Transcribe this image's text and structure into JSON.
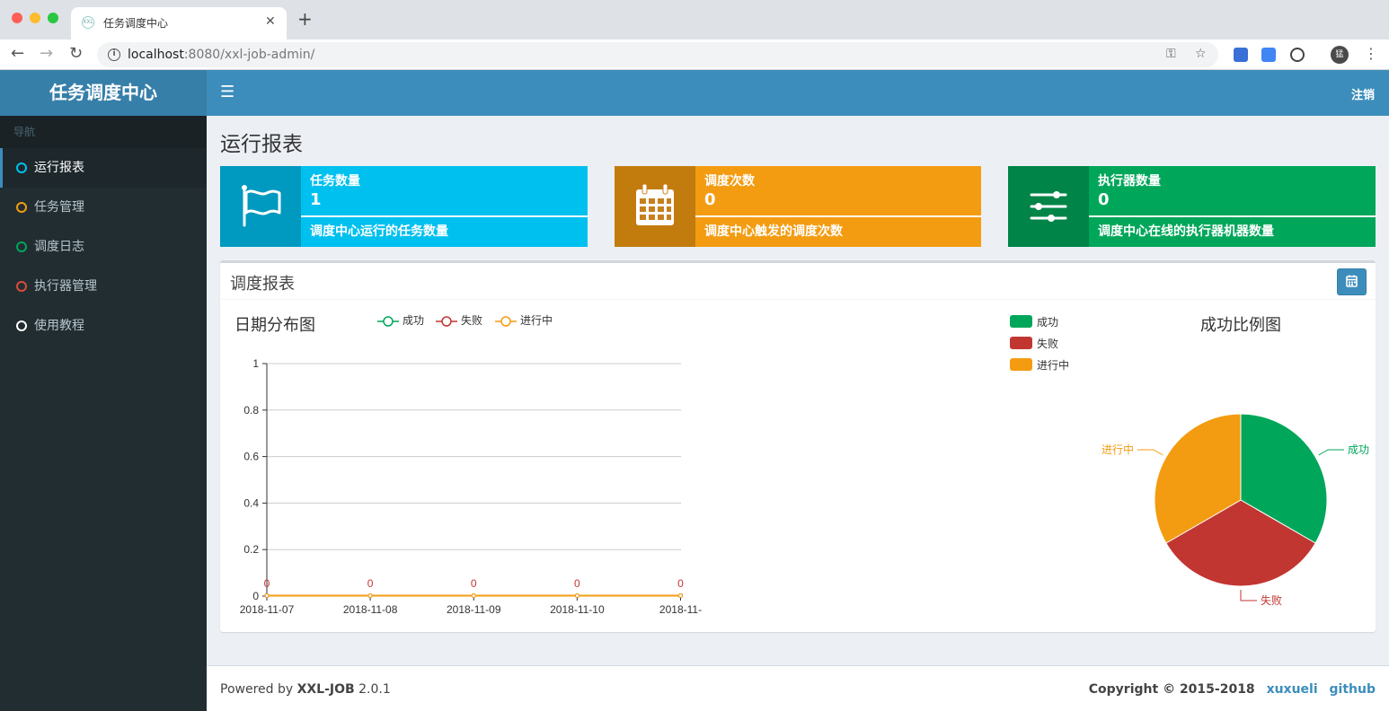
{
  "browser": {
    "tab_title": "任务调度中心",
    "favicon_text": "XXL",
    "url_host": "localhost",
    "url_rest": ":8080/xxl-job-admin/",
    "avatar_text": "猛"
  },
  "app": {
    "logo": "任务调度中心",
    "logout": "注销",
    "nav_header": "导航",
    "nav": [
      {
        "label": "运行报表",
        "color": "#00c0ef",
        "active": true
      },
      {
        "label": "任务管理",
        "color": "#f39c12"
      },
      {
        "label": "调度日志",
        "color": "#00a65a"
      },
      {
        "label": "执行器管理",
        "color": "#dd4b39"
      },
      {
        "label": "使用教程",
        "color": "#ffffff"
      }
    ]
  },
  "page": {
    "title": "运行报表",
    "info_boxes": [
      {
        "title": "任务数量",
        "value": "1",
        "desc": "调度中心运行的任务数量",
        "color": "#00c0ef",
        "icon": "flag-icon"
      },
      {
        "title": "调度次数",
        "value": "0",
        "desc": "调度中心触发的调度次数",
        "color": "#f39c12",
        "icon": "calendar-icon"
      },
      {
        "title": "执行器数量",
        "value": "0",
        "desc": "调度中心在线的执行器机器数量",
        "color": "#00a65a",
        "icon": "sliders-icon"
      }
    ],
    "report": {
      "title": "调度报表",
      "button_icon": "calendar-icon"
    }
  },
  "chart_data": [
    {
      "type": "line",
      "title": "日期分布图",
      "categories": [
        "2018-11-07",
        "2018-11-08",
        "2018-11-09",
        "2018-11-10",
        "2018-11-"
      ],
      "series": [
        {
          "name": "成功",
          "values": [
            0,
            0,
            0,
            0,
            0
          ],
          "color": "#00a65a"
        },
        {
          "name": "失败",
          "values": [
            0,
            0,
            0,
            0,
            0
          ],
          "color": "#c23632"
        },
        {
          "name": "进行中",
          "values": [
            0,
            0,
            0,
            0,
            0
          ],
          "color": "#f39c12"
        }
      ],
      "ylim": [
        0,
        1
      ],
      "yticks": [
        "0",
        "0.2",
        "0.4",
        "0.6",
        "0.8",
        "1"
      ],
      "data_labels": [
        "0",
        "0",
        "0",
        "0",
        "0"
      ],
      "grid": true,
      "legend": "top"
    },
    {
      "type": "pie",
      "title": "成功比例图",
      "labels": [
        "成功",
        "失败",
        "进行中"
      ],
      "values": [
        1,
        1,
        1
      ],
      "colors": [
        "#00a65a",
        "#c23632",
        "#f39c12"
      ],
      "legend": "top-left"
    }
  ],
  "footer": {
    "powered_prefix": "Powered by ",
    "powered_name": "XXL-JOB",
    "version": " 2.0.1",
    "copyright": "Copyright © 2015-2018",
    "link1": "xuxueli",
    "link2": "github"
  }
}
